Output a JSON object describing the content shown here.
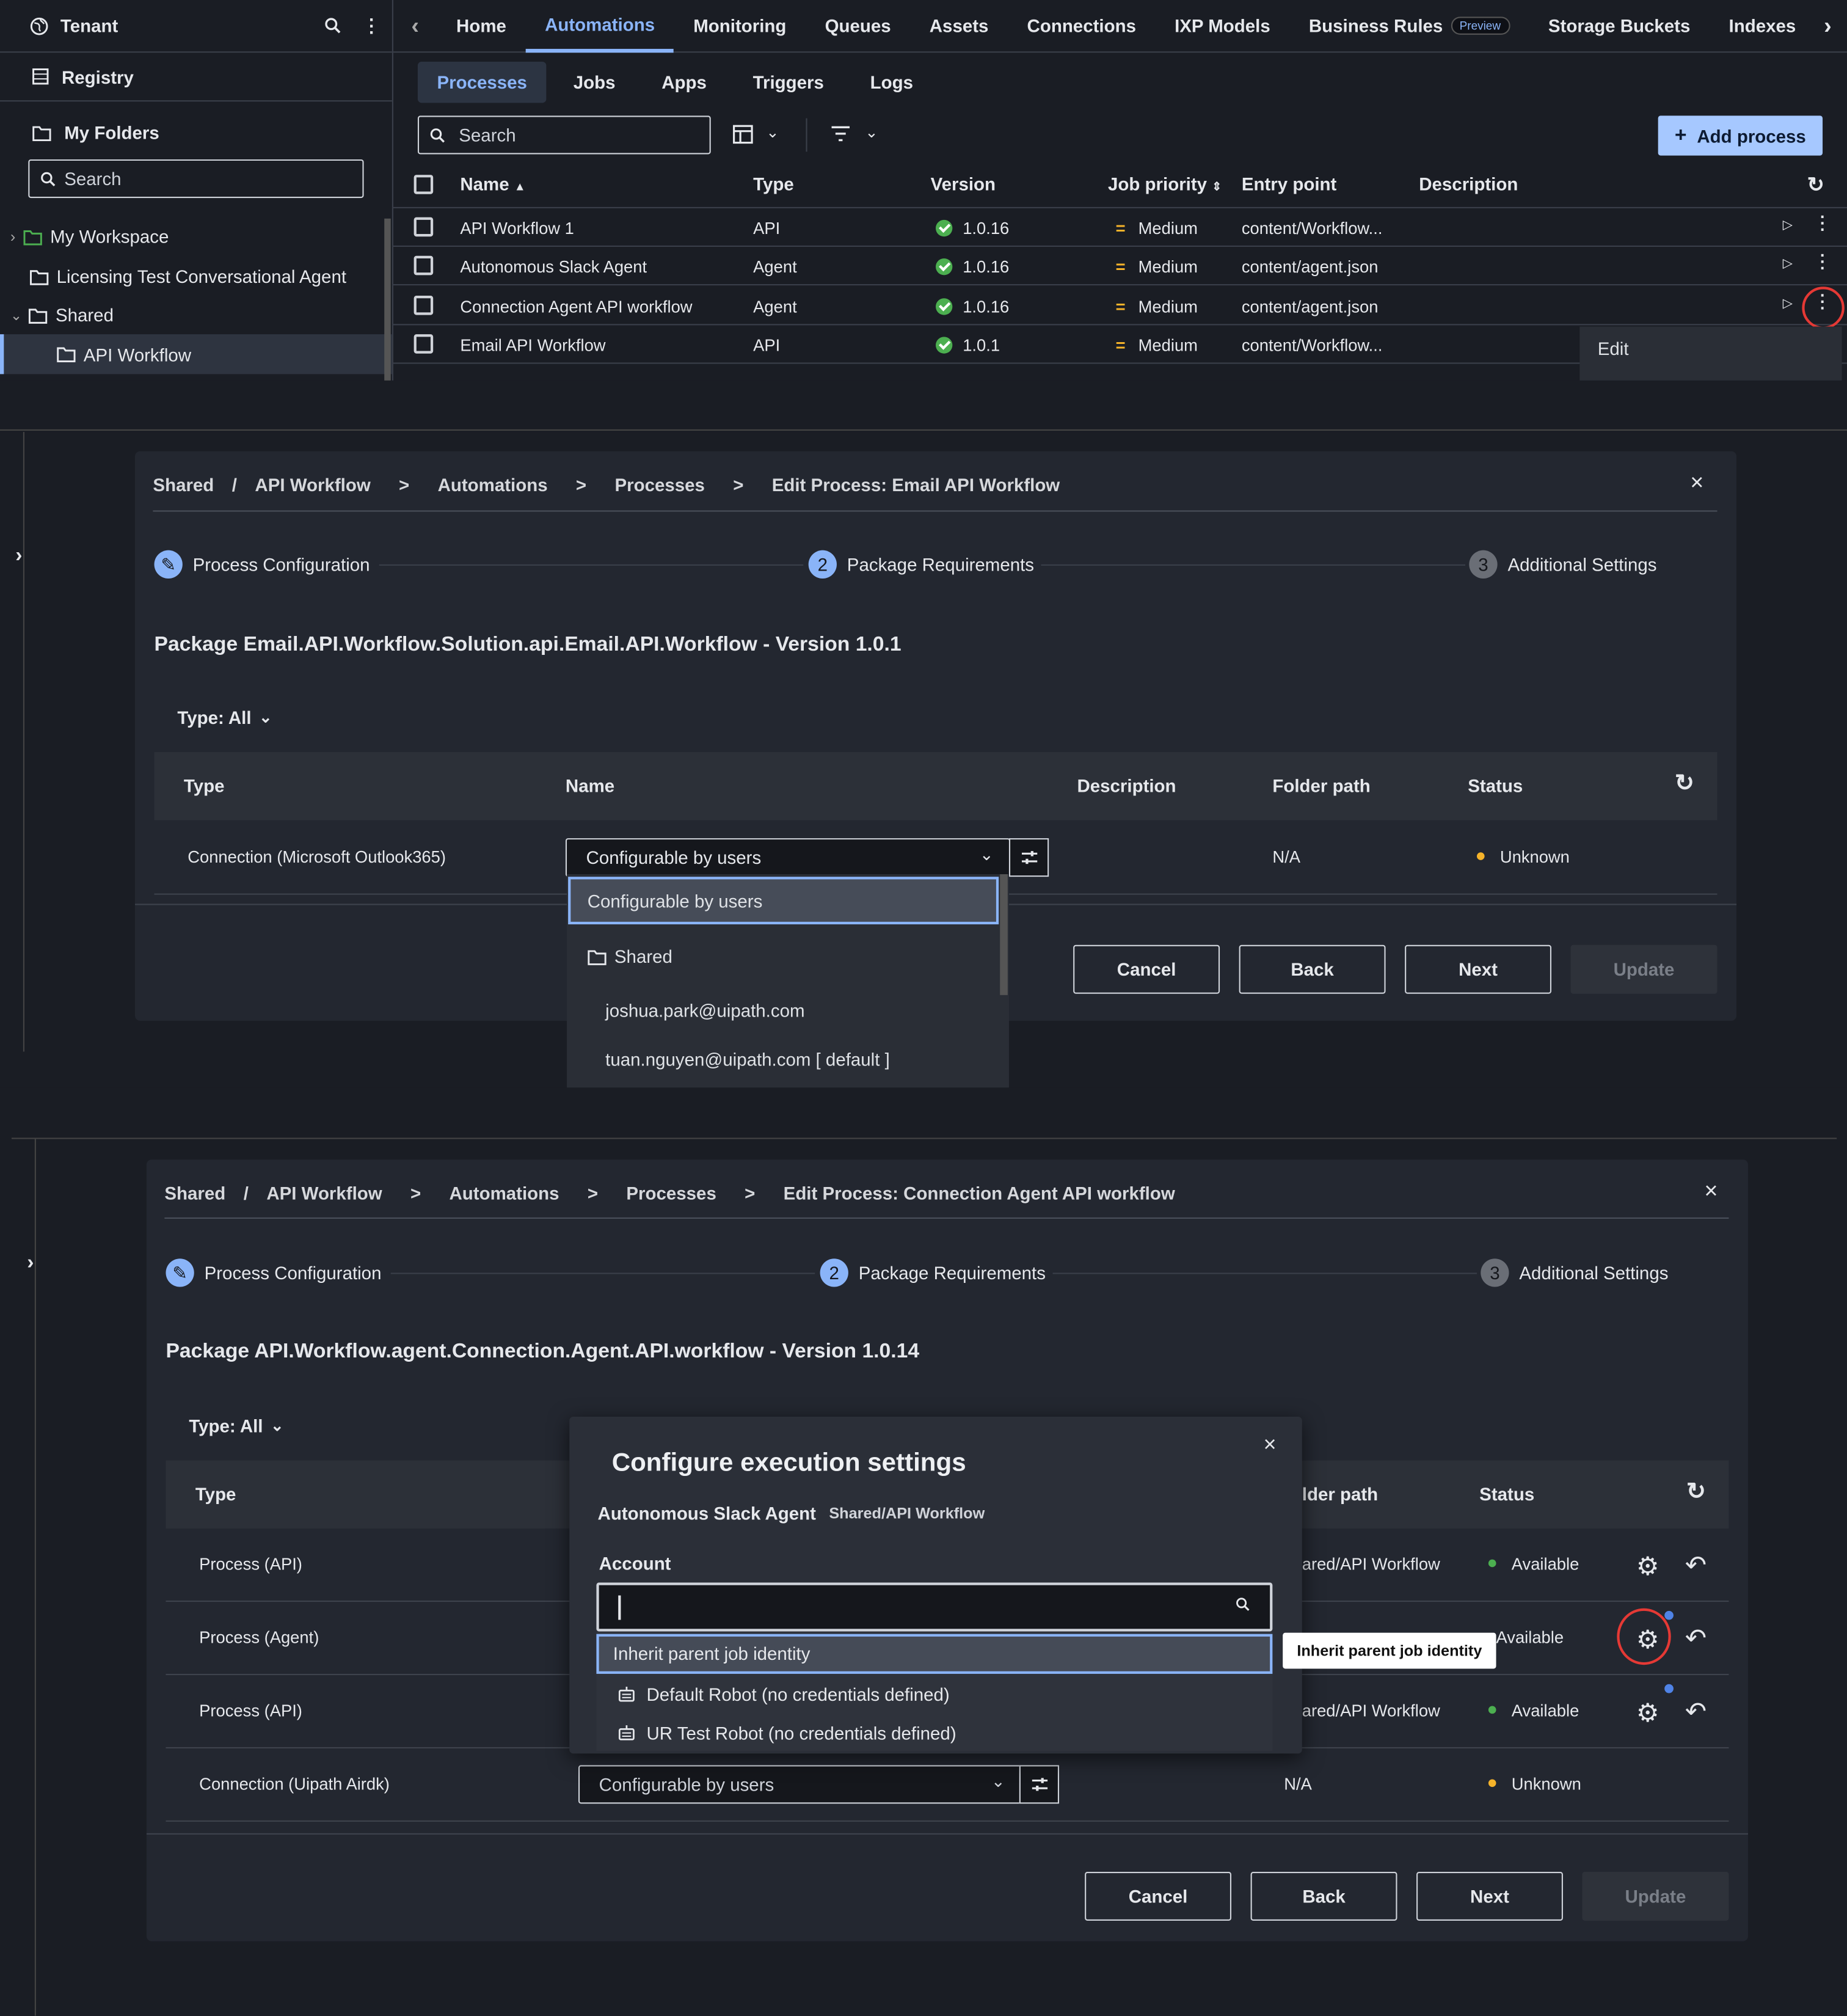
{
  "panel1": {
    "sidebar": {
      "tenant_label": "Tenant",
      "registry_label": "Registry",
      "my_folders_label": "My Folders",
      "search_placeholder": "Search",
      "tree": [
        "My Workspace",
        "Licensing Test Conversational Agent",
        "Shared",
        "API Workflow"
      ]
    },
    "top_tabs": [
      "Home",
      "Automations",
      "Monitoring",
      "Queues",
      "Assets",
      "Connections",
      "IXP Models",
      "Business Rules",
      "Storage Buckets",
      "Indexes"
    ],
    "preview_badge": "Preview",
    "sub_tabs": [
      "Processes",
      "Jobs",
      "Apps",
      "Triggers",
      "Logs"
    ],
    "search_placeholder": "Search",
    "add_process_label": "Add process",
    "columns": [
      "Name",
      "Type",
      "Version",
      "Job priority",
      "Entry point",
      "Description"
    ],
    "rows": [
      {
        "name": "API Workflow 1",
        "type": "API",
        "version": "1.0.16",
        "priority": "Medium",
        "entry": "content/Workflow..."
      },
      {
        "name": "Autonomous Slack Agent",
        "type": "Agent",
        "version": "1.0.16",
        "priority": "Medium",
        "entry": "content/agent.json"
      },
      {
        "name": "Connection Agent API workflow",
        "type": "Agent",
        "version": "1.0.16",
        "priority": "Medium",
        "entry": "content/agent.json"
      },
      {
        "name": "Email API Workflow",
        "type": "API",
        "version": "1.0.1",
        "priority": "Medium",
        "entry": "content/Workflow..."
      }
    ],
    "context_menu_item": "Edit"
  },
  "panel2": {
    "breadcrumb": [
      "Shared",
      "/",
      "API Workflow",
      ">",
      "Automations",
      ">",
      "Processes",
      ">",
      "Edit Process: Email API Workflow"
    ],
    "steps": [
      {
        "num": "",
        "label": "Process Configuration"
      },
      {
        "num": "2",
        "label": "Package Requirements"
      },
      {
        "num": "3",
        "label": "Additional Settings"
      }
    ],
    "package_title": "Package Email.API.Workflow.Solution.api.Email.API.Workflow - Version 1.0.1",
    "type_filter": "Type: All",
    "columns": [
      "Type",
      "Name",
      "Description",
      "Folder path",
      "Status"
    ],
    "row": {
      "type": "Connection (Microsoft Outlook365)",
      "name": "Configurable by users",
      "folder": "N/A",
      "status": "Unknown"
    },
    "dropdown": {
      "selected": "Configurable by users",
      "folder": "Shared",
      "options": [
        "joshua.park@uipath.com",
        "tuan.nguyen@uipath.com [ default ]"
      ]
    },
    "buttons": [
      "Cancel",
      "Back",
      "Next",
      "Update"
    ]
  },
  "panel3": {
    "breadcrumb": [
      "Shared",
      "/",
      "API Workflow",
      ">",
      "Automations",
      ">",
      "Processes",
      ">",
      "Edit Process: Connection Agent API workflow"
    ],
    "steps": [
      {
        "num": "",
        "label": "Process Configuration"
      },
      {
        "num": "2",
        "label": "Package Requirements"
      },
      {
        "num": "3",
        "label": "Additional Settings"
      }
    ],
    "package_title": "Package API.Workflow.agent.Connection.Agent.API.workflow - Version 1.0.14",
    "type_filter": "Type: All",
    "columns": [
      "Type",
      "lder path",
      "Status"
    ],
    "rows": [
      {
        "type": "Process (API)",
        "folder": "ared/API Workflow",
        "status": "Available"
      },
      {
        "type": "Process (Agent)",
        "folder": "",
        "status": "Available"
      },
      {
        "type": "Process (API)",
        "folder": "ared/API Workflow",
        "status": "Available"
      },
      {
        "type": "Connection (Uipath Airdk)",
        "name": "Configurable by users",
        "folder": "N/A",
        "status": "Unknown"
      }
    ],
    "modal": {
      "title": "Configure execution settings",
      "process_name": "Autonomous Slack Agent",
      "process_folder": "Shared/API Workflow",
      "account_label": "Account",
      "options": [
        "Inherit parent job identity",
        "Default Robot (no credentials defined)",
        "UR Test Robot (no credentials defined)"
      ]
    },
    "tooltip": "Inherit parent job identity",
    "buttons": [
      "Cancel",
      "Back",
      "Next",
      "Update"
    ]
  },
  "colors": {
    "accent": "#8ab4f8",
    "available": "#4caf50",
    "unknown": "#f5b32a",
    "highlight": "#e53935"
  }
}
